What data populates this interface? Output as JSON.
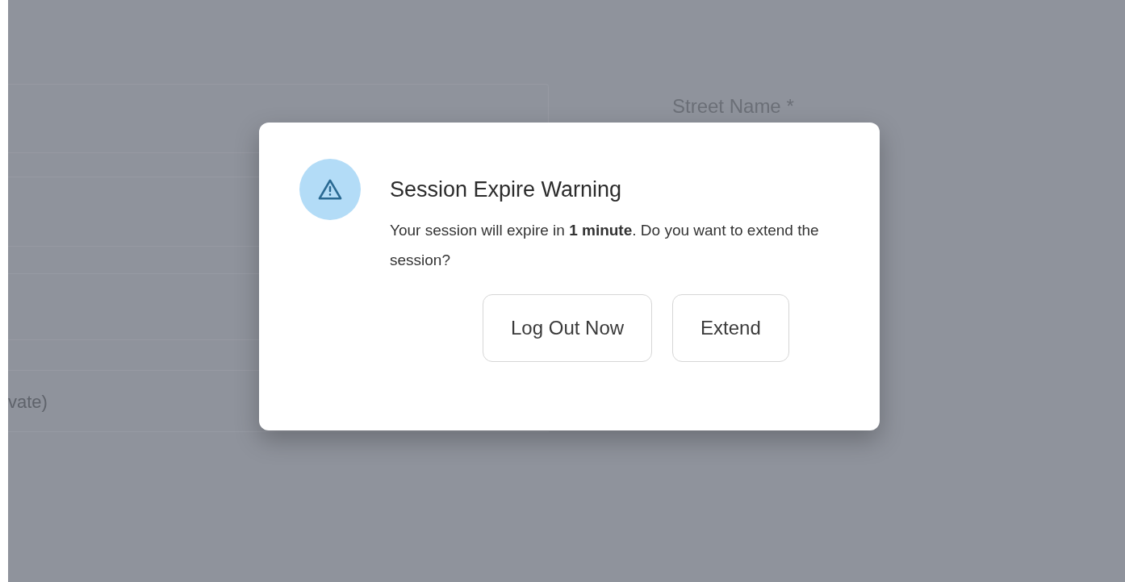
{
  "background_form": {
    "street_label": "Street Name *",
    "cut_label": "vate)"
  },
  "dialog": {
    "title": "Session Expire Warning",
    "message": "Your session will expire in **1 minute**. Do you want to extend the session?",
    "buttons": [
      {
        "label": "Log Out Now"
      },
      {
        "label": "Extend"
      }
    ]
  }
}
